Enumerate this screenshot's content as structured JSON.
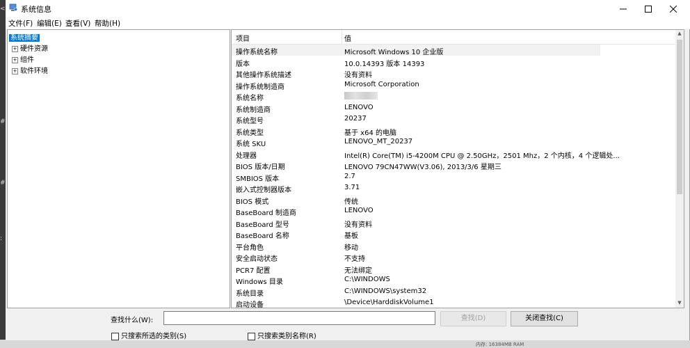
{
  "window": {
    "title": "系统信息"
  },
  "background": {
    "status_text": "内存: 16384MB RAM"
  },
  "menubar": [
    {
      "label": "文件(F)"
    },
    {
      "label": "编辑(E)"
    },
    {
      "label": "查看(V)"
    },
    {
      "label": "帮助(H)"
    }
  ],
  "tree": {
    "selected": "系统摘要",
    "items": [
      {
        "label": "硬件资源"
      },
      {
        "label": "组件"
      },
      {
        "label": "软件环境"
      }
    ]
  },
  "list": {
    "headers": {
      "item": "项目",
      "value": "值"
    },
    "rows": [
      {
        "k": "操作系统名称",
        "v": "Microsoft Windows 10 企业版"
      },
      {
        "k": "版本",
        "v": "10.0.14393 版本 14393"
      },
      {
        "k": "其他操作系统描述",
        "v": "没有资料"
      },
      {
        "k": "操作系统制造商",
        "v": "Microsoft Corporation"
      },
      {
        "k": "系统名称",
        "v": ""
      },
      {
        "k": "系统制造商",
        "v": "LENOVO"
      },
      {
        "k": "系统型号",
        "v": "20237"
      },
      {
        "k": "系统类型",
        "v": "基于 x64 的电脑"
      },
      {
        "k": "系统 SKU",
        "v": "LENOVO_MT_20237"
      },
      {
        "k": "处理器",
        "v": "Intel(R) Core(TM) i5-4200M CPU @ 2.50GHz，2501 Mhz，2 个内核，4 个逻辑处..."
      },
      {
        "k": "BIOS 版本/日期",
        "v": "LENOVO 79CN47WW(V3.06), 2013/3/6 星期三"
      },
      {
        "k": "SMBIOS 版本",
        "v": "2.7"
      },
      {
        "k": "嵌入式控制器版本",
        "v": "3.71"
      },
      {
        "k": "BIOS 模式",
        "v": "传统"
      },
      {
        "k": "BaseBoard 制造商",
        "v": "LENOVO"
      },
      {
        "k": "BaseBoard 型号",
        "v": "没有资料"
      },
      {
        "k": "BaseBoard 名称",
        "v": "基板"
      },
      {
        "k": "平台角色",
        "v": "移动"
      },
      {
        "k": "安全启动状态",
        "v": "不支持"
      },
      {
        "k": "PCR7 配置",
        "v": "无法绑定"
      },
      {
        "k": "Windows 目录",
        "v": "C:\\WINDOWS"
      },
      {
        "k": "系统目录",
        "v": "C:\\WINDOWS\\system32"
      },
      {
        "k": "启动设备",
        "v": "\\Device\\HarddiskVolume1"
      }
    ]
  },
  "search": {
    "label": "查找什么(W):",
    "value": "",
    "find_button": "查找(D)",
    "close_button": "关闭查找(C)",
    "only_selected": "只搜索所选的类别(S)",
    "only_names": "只搜索类别名称(R)"
  }
}
